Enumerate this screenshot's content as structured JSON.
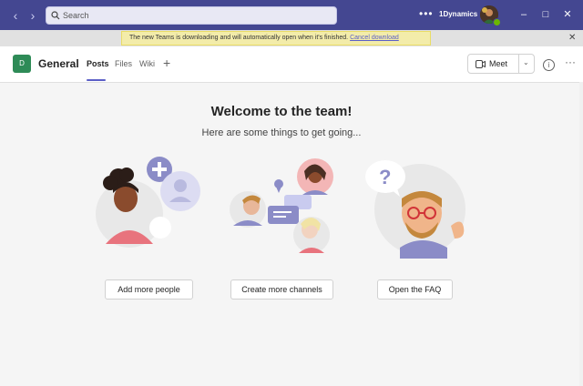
{
  "titlebar": {
    "search_placeholder": "Search",
    "more_label": "•••",
    "org_name": "1Dynamics",
    "window_controls": [
      "minimize",
      "maximize",
      "close"
    ]
  },
  "banner": {
    "message": "The new Teams is downloading and will automatically open when it's finished.",
    "link": "Cancel download",
    "close_label": "✕"
  },
  "header": {
    "team_initial": "D",
    "channel_name": "General",
    "tabs": [
      {
        "label": "Posts",
        "active": true
      },
      {
        "label": "Files",
        "active": false
      },
      {
        "label": "Wiki",
        "active": false
      }
    ],
    "add_tab_label": "+",
    "meet_label": "Meet",
    "info_label": "i",
    "more_label": "···"
  },
  "main": {
    "title": "Welcome to the team!",
    "subtitle": "Here are some things to get going...",
    "actions": [
      {
        "label": "Add more people",
        "icon": "add-person-illustration"
      },
      {
        "label": "Create more channels",
        "icon": "channels-illustration"
      },
      {
        "label": "Open the FAQ",
        "icon": "faq-illustration"
      }
    ]
  },
  "colors": {
    "titlebar": "#444791",
    "accent": "#5b5fc7",
    "banner_bg": "#f3ecaa",
    "team_tile": "#2e8b57",
    "presence": "#6bb700"
  }
}
